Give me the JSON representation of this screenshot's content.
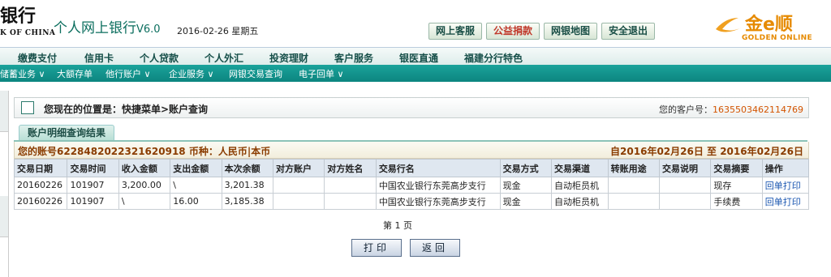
{
  "header": {
    "bank_name": "银行",
    "bank_sub": "K OF CHINA",
    "app_title": "个人网上银行",
    "app_version": "V6.0",
    "date": "2016-02-26 星期五",
    "buttons": [
      "网上客服",
      "公益捐款",
      "网银地图",
      "安全退出"
    ],
    "brand_cn": "金e顺",
    "brand_en": "GOLDEN ONLINE"
  },
  "nav_main": [
    "缴费支付",
    "信用卡",
    "个人贷款",
    "个人外汇",
    "投资理财",
    "客户服务",
    "银医直通",
    "福建分行特色"
  ],
  "nav_sub": [
    "储蓄业务 ∨",
    "大额存单",
    "他行账户 ∨",
    "企业服务 ∨",
    "网银交易查询",
    "电子回单 ∨"
  ],
  "location": {
    "label": "您现在的位置是：快捷菜单>账户查询",
    "customer_label": "您的客户号：",
    "customer_no": "1635503462114769"
  },
  "tab": "账户明细查询结果",
  "account": {
    "info": "您的账号6228482022321620918 币种：人民币|本币",
    "range": "自2016年02月26日  至  2016年02月26日"
  },
  "table": {
    "headers": [
      "交易日期",
      "交易时间",
      "收入金额",
      "支出金额",
      "本次余额",
      "对方账户",
      "对方姓名",
      "交易行名",
      "交易方式",
      "交易渠道",
      "转账用途",
      "交易说明",
      "交易摘要",
      "操作"
    ],
    "rows": [
      [
        "20160226",
        "101907",
        "3,200.00",
        "\\",
        "3,201.38",
        "",
        "",
        "中国农业银行东莞高步支行",
        "现金",
        "自动柜员机",
        "",
        "",
        "现存",
        "回单打印"
      ],
      [
        "20160226",
        "101907",
        "\\",
        "16.00",
        "3,185.38",
        "",
        "",
        "中国农业银行东莞高步支行",
        "现金",
        "自动柜员机",
        "",
        "",
        "手续费",
        "回单打印"
      ]
    ]
  },
  "page_label": "第 1 页",
  "actions": {
    "print": "打印",
    "back": "返回"
  }
}
